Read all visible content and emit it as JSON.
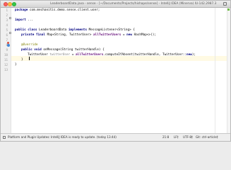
{
  "window": {
    "title": "LeaderboardData.java - sense - [~/Documents/Projects/hishape/sense] - IntelliJ IDEA (Minerva) IU-142.2987.3"
  },
  "gutter": {
    "line_numbers": [
      "1",
      "2",
      "3",
      "4",
      "5",
      "6",
      "7",
      "8",
      "9",
      "10",
      "11",
      "12",
      "13"
    ]
  },
  "code": {
    "package_kw": "package",
    "package_name": " com.mechanitis.demo.sense.client.user;",
    "import_kw": "import",
    "import_rest": " ...",
    "class_decl_kw": "public class",
    "class_decl_name": " LeaderboardData ",
    "implements_kw": "implements",
    "class_decl_rest": " MessageListener<String> {",
    "field_kw": "private final",
    "field_type": " Map<String, TwitterUser> ",
    "field_name": "allTwitterUsers",
    "field_assign": " = ",
    "field_new_kw": "new",
    "field_rest": " HashMap<>();",
    "override": "@Override",
    "method_kw": "public void",
    "method_rest": " onMessage(String twitterHandle) {",
    "body_type": "TwitterUser ",
    "body_var": "twitterUser",
    "body_assign": " = ",
    "body_field": "allTwitterUsers",
    "body_call": ".computeIfAbsent(twitterHandle, TwitterUser::",
    "body_new_kw": "new",
    "body_end": ");",
    "close_method": "}",
    "close_class": "}"
  },
  "status": {
    "message": "Platform and Plugin Updates: IntelliJ IDEA is ready to update. (today 13:44)",
    "position": "21:8",
    "line_sep": "LF‡",
    "encoding": "UTF-8‡",
    "shortcut": "Git: ctrl-article‡",
    "lock": "",
    "extra": ""
  }
}
